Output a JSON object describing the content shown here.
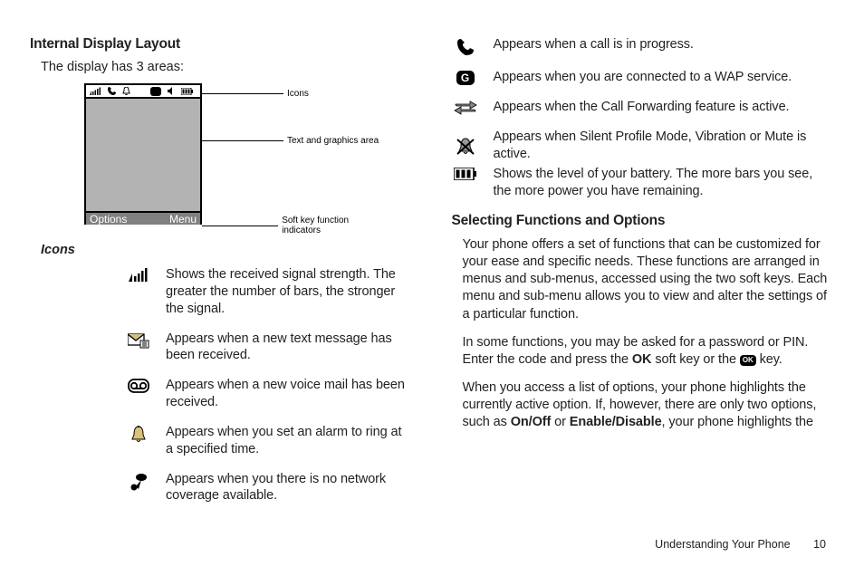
{
  "left": {
    "heading": "Internal Display Layout",
    "intro": "The display has 3 areas:",
    "display": {
      "softkey_left": "Options",
      "softkey_right": "Menu",
      "callouts": {
        "icons": "Icons",
        "text_area": "Text and graphics area",
        "soft_keys": "Soft key function indicators"
      }
    },
    "icons_subhead": "Icons",
    "icons": [
      {
        "name": "signal-icon",
        "text": "Shows the received signal strength. The greater the number of bars, the stronger the signal."
      },
      {
        "name": "message-icon",
        "text": "Appears when a new text message has been received."
      },
      {
        "name": "voicemail-icon",
        "text": "Appears when a new voice mail has been received."
      },
      {
        "name": "alarm-icon",
        "text": "Appears when you set an alarm to ring at a specified time."
      },
      {
        "name": "no-network-icon",
        "text": "Appears when you there is no network coverage available."
      }
    ]
  },
  "right": {
    "icons": [
      {
        "name": "call-icon",
        "text": "Appears when a call is in progress."
      },
      {
        "name": "wap-g-icon",
        "text": "Appears when you are connected to a WAP service."
      },
      {
        "name": "call-forward-icon",
        "text": "Appears when the Call Forwarding feature is active."
      },
      {
        "name": "silent-vibrate-icon",
        "text": "Appears when Silent Profile Mode, Vibration or Mute is active."
      },
      {
        "name": "battery-icon",
        "text": "Shows the level of your battery. The more bars you see, the more power you have remaining."
      }
    ],
    "heading": "Selecting Functions and Options",
    "p1": "Your phone offers a set of functions that can be customized for your ease and specific needs. These functions are arranged in menus and sub-menus, accessed using the two soft keys. Each menu and sub-menu allows you to view and alter the settings of a particular function.",
    "p2_a": "In some functions, you may be asked for a password or PIN. Enter the code and press the ",
    "p2_ok": "OK",
    "p2_b": " soft key or the ",
    "p2_badge": "OK",
    "p2_c": " key.",
    "p3_a": "When you access a list of options, your phone highlights the currently active option. If, however, there are only two options, such as ",
    "p3_onoff": "On/Off",
    "p3_b": " or ",
    "p3_enable": "Enable/Disable",
    "p3_c": ", your phone highlights the"
  },
  "footer": {
    "section": "Understanding Your Phone",
    "page": "10"
  }
}
